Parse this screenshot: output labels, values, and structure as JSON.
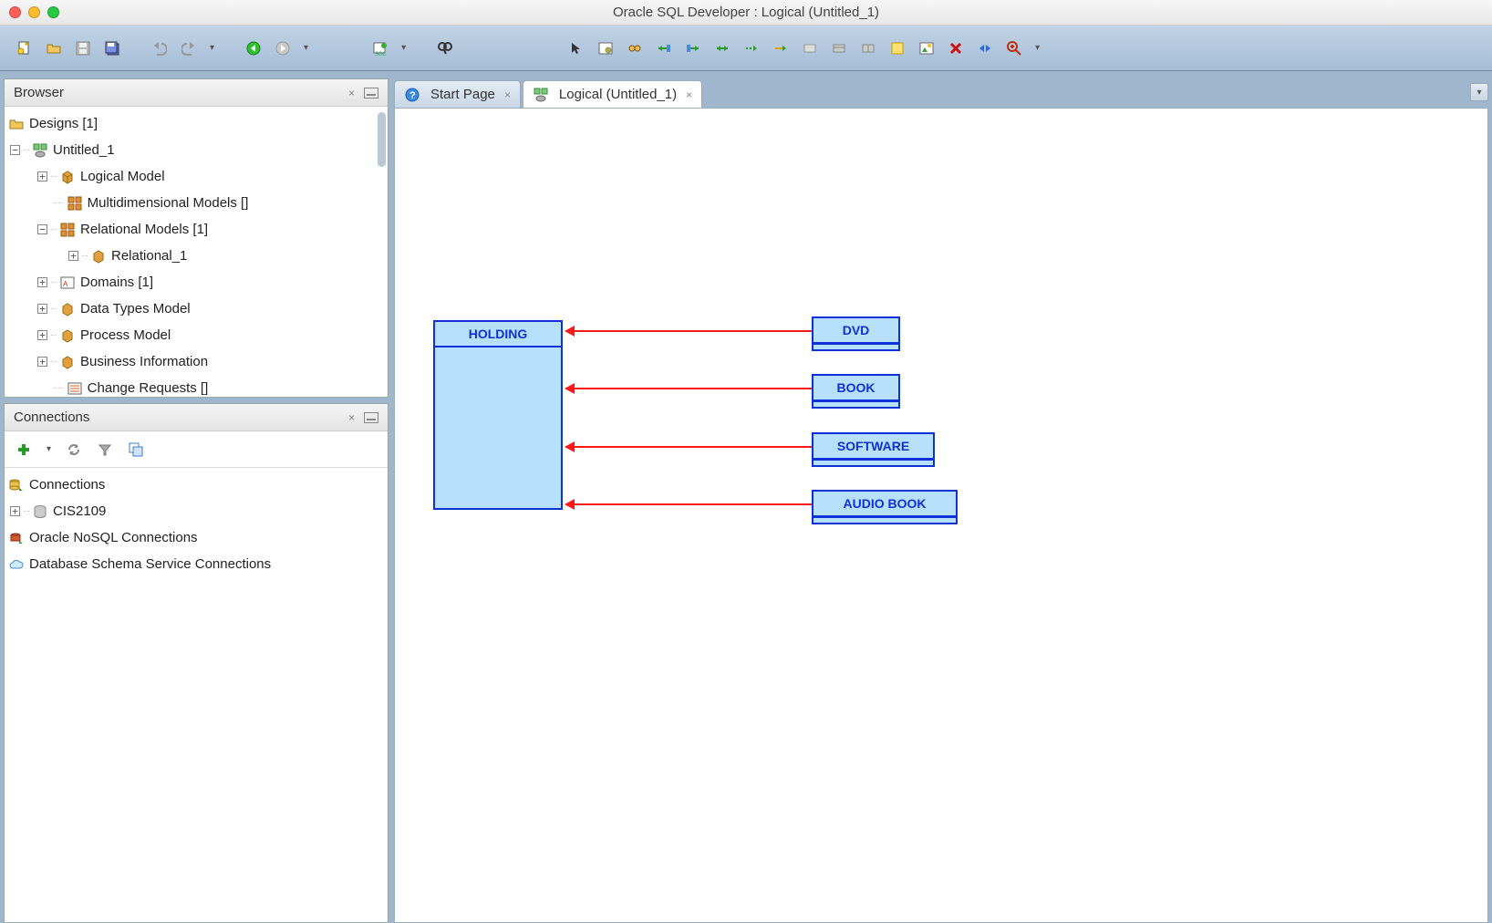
{
  "window": {
    "title": "Oracle SQL Developer : Logical (Untitled_1)"
  },
  "toolbar_icons": [
    "new",
    "open",
    "save",
    "save-all",
    "",
    "undo",
    "redo",
    "drop",
    "",
    "back",
    "fwd",
    "drop",
    "",
    "sql",
    "",
    "find",
    "",
    "",
    "",
    "cursor",
    "settings",
    "glasses",
    "link1",
    "link2",
    "link3",
    "link4",
    "arrow",
    "rect",
    "rect2",
    "rect3",
    "note",
    "image",
    "delete",
    "play",
    "zoom",
    "drop"
  ],
  "browser": {
    "title": "Browser",
    "tree": {
      "root": "Designs [1]",
      "design": "Untitled_1",
      "items": [
        "Logical Model",
        "Multidimensional Models []",
        "Relational Models [1]",
        "Relational_1",
        "Domains [1]",
        "Data Types Model",
        "Process Model",
        "Business Information",
        "Change Requests []"
      ]
    }
  },
  "connections": {
    "title": "Connections",
    "items": [
      "Connections",
      "CIS2109",
      "Oracle NoSQL Connections",
      "Database Schema Service Connections"
    ]
  },
  "tabs": {
    "start": "Start Page",
    "logical": "Logical (Untitled_1)"
  },
  "diagram": {
    "main_entity": "HOLDING",
    "children": [
      "DVD",
      "BOOK",
      "SOFTWARE",
      "AUDIO BOOK"
    ]
  }
}
